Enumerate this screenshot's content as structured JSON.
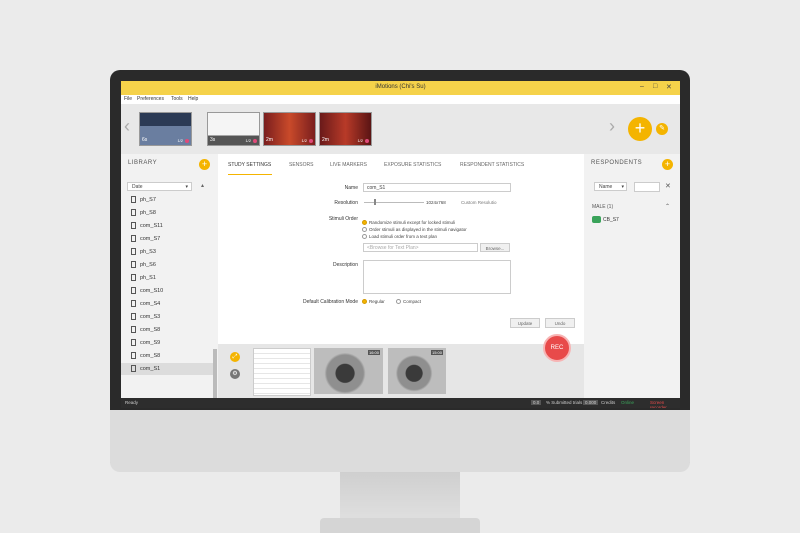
{
  "window": {
    "title": "iMotions (Chi's Su)",
    "min": "–",
    "max": "□",
    "close": "✕"
  },
  "menu": [
    "File",
    "Preferences",
    "Tools",
    "Help"
  ],
  "thumbnails": [
    {
      "label": "6s",
      "count": "1/2"
    },
    {
      "label": "3s",
      "count": "1/2"
    },
    {
      "label": "2m",
      "count": "1/2"
    },
    {
      "label": "2m",
      "count": "1/2"
    }
  ],
  "nav": {
    "prev": "‹",
    "next": "›",
    "add": "+",
    "edit": "✎"
  },
  "library": {
    "title": "LIBRARY",
    "add": "+",
    "sort": "Date",
    "items": [
      "ph_S7",
      "ph_S8",
      "com_S11",
      "com_S7",
      "ph_S3",
      "ph_S6",
      "ph_S1",
      "com_S10",
      "com_S4",
      "com_S3",
      "com_S8",
      "com_S9",
      "com_S8",
      "com_S1"
    ]
  },
  "tabs": [
    "STUDY SETTINGS",
    "SENSORS",
    "LIVE MARKERS",
    "EXPOSURE STATISTICS",
    "RESPONDENT STATISTICS"
  ],
  "settings": {
    "name_label": "Name",
    "name_value": "com_S1",
    "resolution_label": "Resolution",
    "resolution_value": "1024x768",
    "custom_resolution": "Custom Resolutio",
    "stimuli_order_label": "Stimuli Order",
    "order_options": [
      "Randomize stimuli except for locked stimuli",
      "Order stimuli as displayed in the stimuli navigator",
      "Load stimuli order from a text plan"
    ],
    "browse_placeholder": "<Browse for Text Plan>",
    "browse_button": "Browse...",
    "description_label": "Description",
    "calibration_label": "Default Calibration Mode",
    "calibration_regular": "Regular",
    "calibration_compact": "Compact",
    "update_button": "Update",
    "undo_button": "Undo"
  },
  "previews": {
    "cam1_label": "16:00",
    "cam2_label": "15:00"
  },
  "rec": "REC",
  "respondents": {
    "title": "RESPONDENTS",
    "add": "+",
    "filter": "Name",
    "clear": "✕",
    "group": "MALE (1)",
    "collapse": "⌃",
    "item": "CB_S7"
  },
  "status": {
    "ready": "Ready",
    "left_count": "0.0",
    "left_text": "% Submitted trials",
    "mid_count": "0.000",
    "mid_text": "Credits",
    "right1": "Online",
    "right2": "Screen recorder"
  },
  "colors": {
    "accent": "#f4b400",
    "rec": "#e84a4a"
  }
}
